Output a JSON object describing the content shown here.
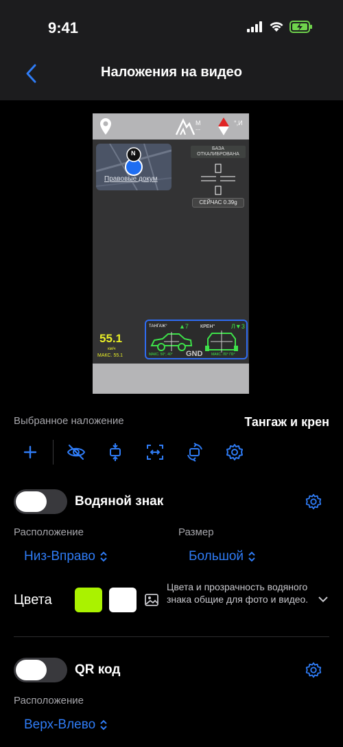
{
  "status": {
    "time": "9:41"
  },
  "nav": {
    "title": "Наложения на видео"
  },
  "preview": {
    "calibration_text_1": "БАЗА",
    "calibration_text_2": "ОТКАЛИБРОВАНА",
    "now_text": "СЕЙЧАС 0.39g",
    "speed": "55.1",
    "speed_unit": "км/ч",
    "speed_max": "МАКС. 55.1",
    "map_text": "Правовые докум",
    "compass_letter": "N",
    "altitude_unit": "М",
    "altitude_value": "---",
    "heading_unit": "°,И",
    "pitch_label": "ТАНГАЖ°",
    "pitch_value": "▲7",
    "roll_label": "КРЕН°",
    "roll_value": "Л▼3",
    "pitch_max": "МАКС. 50°, 40°",
    "roll_max": "МАКС. Л0° П0°",
    "gnd": "GND"
  },
  "selected_overlay": {
    "label": "Выбранное наложение",
    "value": "Тангаж и крен"
  },
  "watermark": {
    "title": "Водяной знак",
    "enabled": false,
    "position_label": "Расположение",
    "position_value": "Низ-Вправо",
    "size_label": "Размер",
    "size_value": "Большой",
    "colors_label": "Цвета",
    "color_1": "#aaf200",
    "color_2": "#ffffff",
    "note": "Цвета и прозрачность водяного знака общие для фото и видео."
  },
  "qr": {
    "title": "QR код",
    "enabled": false,
    "position_label": "Расположение",
    "position_value": "Верх-Влево"
  },
  "accent": "#2f7cf6"
}
